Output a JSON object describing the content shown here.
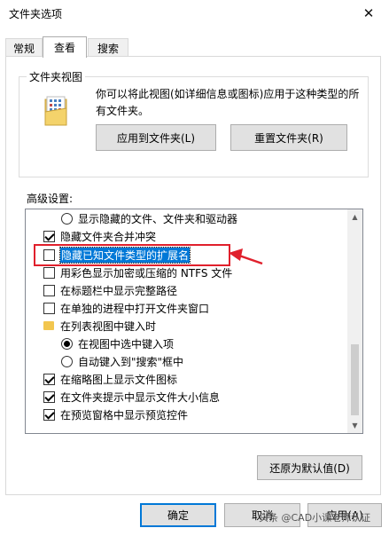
{
  "window": {
    "title": "文件夹选项",
    "close_glyph": "✕"
  },
  "tabs": [
    {
      "label": "常规",
      "active": false
    },
    {
      "label": "查看",
      "active": true
    },
    {
      "label": "搜索",
      "active": false
    }
  ],
  "folder_views": {
    "legend": "文件夹视图",
    "description": "你可以将此视图(如详细信息或图标)应用于这种类型的所有文件夹。",
    "apply_button": "应用到文件夹(L)",
    "reset_button": "重置文件夹(R)"
  },
  "advanced": {
    "label": "高级设置:",
    "items": [
      {
        "kind": "radio",
        "indent": 1,
        "checked": false,
        "label": "显示隐藏的文件、文件夹和驱动器"
      },
      {
        "kind": "checkbox",
        "indent": 0,
        "checked": true,
        "label": "隐藏文件夹合并冲突"
      },
      {
        "kind": "checkbox",
        "indent": 0,
        "checked": false,
        "label": "隐藏已知文件类型的扩展名",
        "selected": true
      },
      {
        "kind": "checkbox",
        "indent": 0,
        "checked": false,
        "label": "用彩色显示加密或压缩的 NTFS 文件"
      },
      {
        "kind": "checkbox",
        "indent": 0,
        "checked": false,
        "label": "在标题栏中显示完整路径"
      },
      {
        "kind": "checkbox",
        "indent": 0,
        "checked": false,
        "label": "在单独的进程中打开文件夹窗口"
      },
      {
        "kind": "folder",
        "indent": 0,
        "label": "在列表视图中键入时"
      },
      {
        "kind": "radio",
        "indent": 1,
        "checked": true,
        "label": "在视图中选中键入项"
      },
      {
        "kind": "radio",
        "indent": 1,
        "checked": false,
        "label": "自动键入到\"搜索\"框中"
      },
      {
        "kind": "checkbox",
        "indent": 0,
        "checked": true,
        "label": "在缩略图上显示文件图标"
      },
      {
        "kind": "checkbox",
        "indent": 0,
        "checked": true,
        "label": "在文件夹提示中显示文件大小信息"
      },
      {
        "kind": "checkbox",
        "indent": 0,
        "checked": true,
        "label": "在预览窗格中显示预览控件"
      }
    ],
    "restore_button": "还原为默认值(D)"
  },
  "footer": {
    "ok": "确定",
    "cancel": "取消",
    "apply": "应用(A)"
  },
  "watermark": "头条 @CAD小课老师认证",
  "colors": {
    "selection": "#0078d7",
    "annotation": "#e0202c",
    "folder": "#f2c64f"
  }
}
